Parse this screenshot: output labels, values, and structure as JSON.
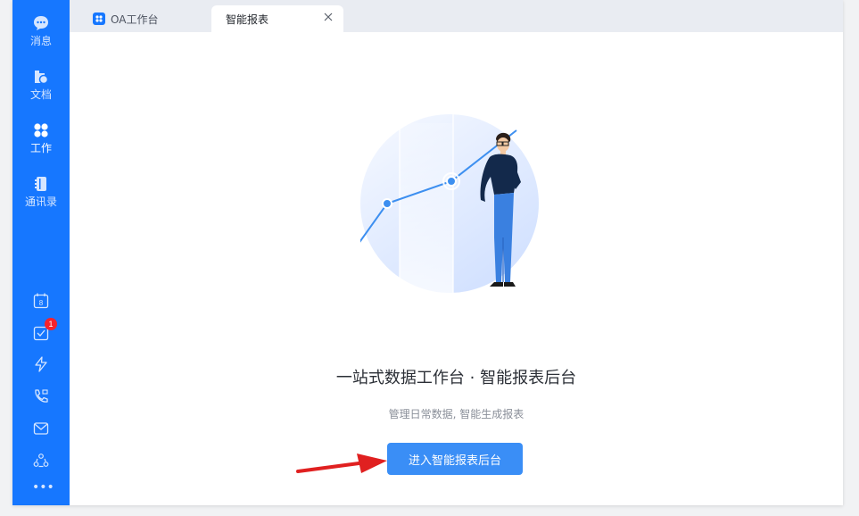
{
  "sidebar": {
    "items": [
      {
        "label": "消息",
        "icon": "chat-bubble-icon"
      },
      {
        "label": "文档",
        "icon": "folder-icon"
      },
      {
        "label": "工作",
        "icon": "grid-apps-icon"
      },
      {
        "label": "通讯录",
        "icon": "contacts-book-icon"
      }
    ],
    "active_index": 2,
    "tools": [
      "calendar-icon",
      "todo-check-icon",
      "lightning-icon",
      "phone-video-icon",
      "mail-icon",
      "group-icon"
    ],
    "calendar_day": "8",
    "todo_badge": "1",
    "more": "•••"
  },
  "tabs": [
    {
      "label": "OA工作台",
      "icon": "app-grid-icon"
    },
    {
      "label": "智能报表",
      "active": true
    }
  ],
  "main": {
    "headline": "一站式数据工作台 · 智能报表后台",
    "subtitle": "管理日常数据, 智能生成报表",
    "cta_label": "进入智能报表后台"
  },
  "colors": {
    "sidebar_bg": "#1677ff",
    "button_bg": "#3a8ef6",
    "arrow": "#e02020",
    "badge": "#f5222d"
  }
}
